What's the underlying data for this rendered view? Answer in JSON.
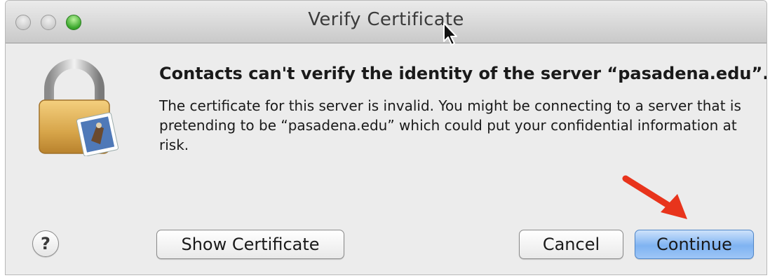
{
  "window": {
    "title": "Verify Certificate"
  },
  "dialog": {
    "headline": "Contacts can't verify the identity of the server “pasadena.edu”.",
    "message": "The certificate for this server is invalid. You might be connecting to a server that is pretending to be “pasadena.edu” which could put your confidential information at risk."
  },
  "buttons": {
    "help_label": "?",
    "show_certificate_label": "Show Certificate",
    "cancel_label": "Cancel",
    "continue_label": "Continue"
  },
  "icons": {
    "lock": "lock-icon",
    "badge": "contacts-stamp-icon",
    "annotation": "red-arrow-icon"
  },
  "colors": {
    "default_button": "#7fb3f2",
    "annotation_arrow": "#e8341c"
  }
}
